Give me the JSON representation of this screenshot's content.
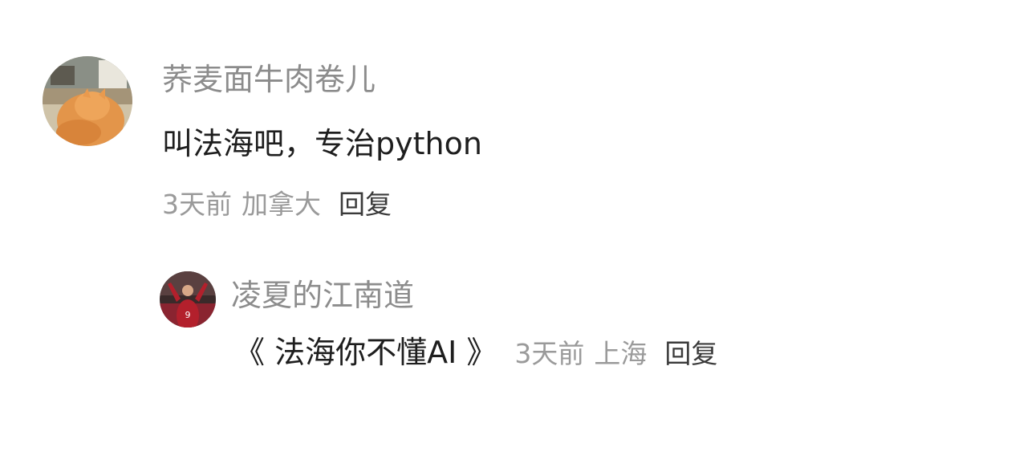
{
  "comment": {
    "avatar": "cat-avatar",
    "username": "荞麦面牛肉卷儿",
    "text": "叫法海吧，专治python",
    "time": "3天前",
    "location": "加拿大",
    "reply_label": "回复"
  },
  "reply": {
    "avatar": "football-player-avatar",
    "username": "凌夏的江南道",
    "text": "《 法海你不懂AI 》",
    "time": "3天前",
    "location": "上海",
    "reply_label": "回复"
  },
  "colors": {
    "username": "#8c8c8c",
    "content": "#1e1e1e",
    "meta": "#9a9a9a",
    "reply_button": "#3a3a3a"
  }
}
